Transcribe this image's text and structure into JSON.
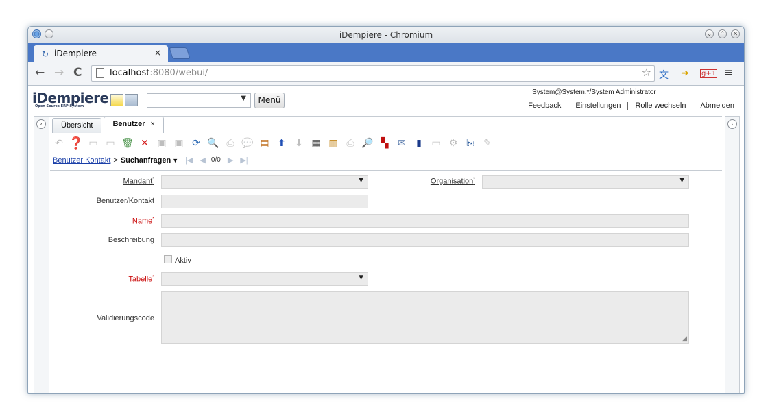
{
  "window": {
    "title": "iDempiere - Chromium"
  },
  "browser": {
    "tab_title": "iDempiere",
    "tab_close": "×",
    "url_host": "localhost",
    "url_path": ":8080/webui/"
  },
  "header": {
    "logo": "iDempiere",
    "logo_sub": "Open Source ERP System",
    "menu_label": "Menü",
    "user_info": "System@System.*/System Administrator",
    "links": [
      "Feedback",
      "Einstellungen",
      "Rolle wechseln",
      "Abmelden"
    ]
  },
  "tabs": {
    "overview": "Übersicht",
    "active": "Benutzer",
    "close": "×"
  },
  "breadcrumb": {
    "link": "Benutzer Kontakt",
    "sep": ">",
    "current": "Suchanfragen",
    "record": "0/0"
  },
  "form": {
    "mandant": "Mandant",
    "organisation": "Organisation",
    "benutzer_kontakt": "Benutzer/Kontakt",
    "name": "Name",
    "beschreibung": "Beschreibung",
    "aktiv": "Aktiv",
    "tabelle": "Tabelle",
    "validierungscode": "Validierungscode",
    "required_mark": "*"
  }
}
